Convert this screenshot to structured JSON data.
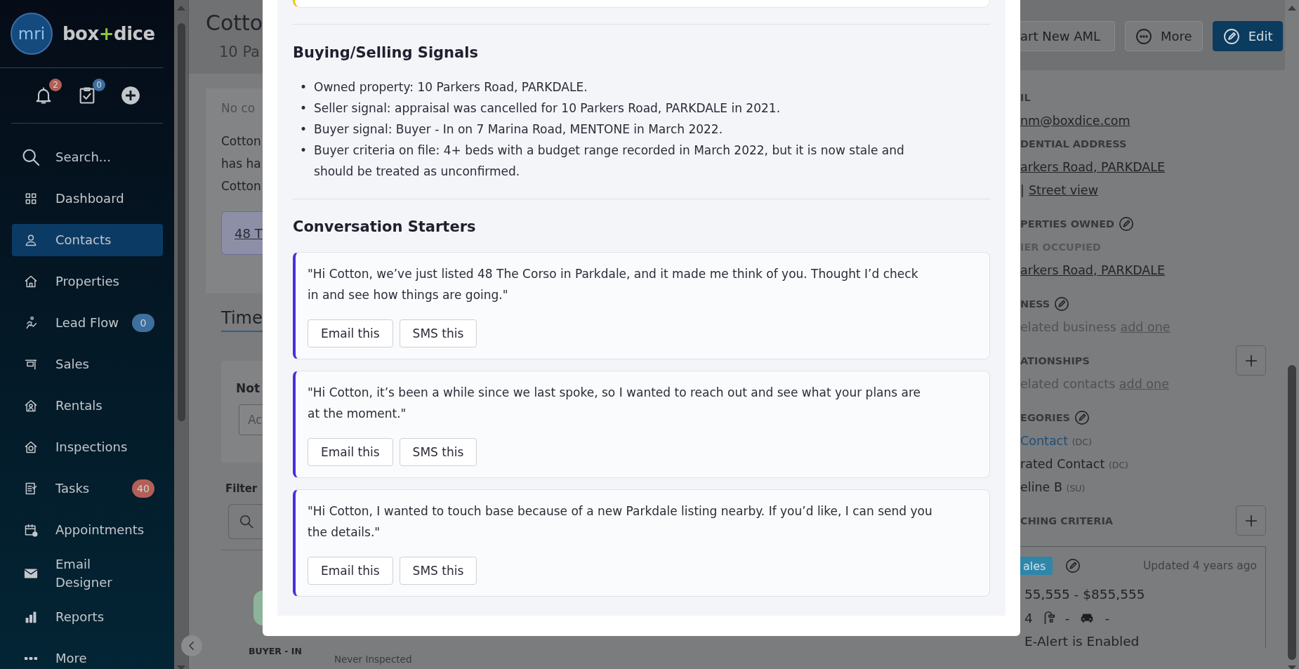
{
  "sidebar": {
    "logo_mark": "mri",
    "brand": {
      "before": "box",
      "joiner": "+",
      "after": "dice"
    },
    "quick_actions": [
      {
        "kind": "notifications",
        "count": "2",
        "color": "#b35f57"
      },
      {
        "kind": "tasks",
        "count": "0",
        "color": "#3d6f9f"
      },
      {
        "kind": "create"
      }
    ],
    "items": [
      {
        "kind": "search",
        "label": "Search...",
        "selected": false
      },
      {
        "kind": "link",
        "label": "Dashboard",
        "selected": false
      },
      {
        "kind": "link",
        "label": "Contacts",
        "selected": true
      },
      {
        "kind": "link",
        "label": "Properties",
        "selected": false
      },
      {
        "kind": "link",
        "label": "Lead Flow",
        "selected": false,
        "badge": "0",
        "color": "#3d6f9f"
      },
      {
        "kind": "link",
        "label": "Sales",
        "selected": false
      },
      {
        "kind": "link",
        "label": "Rentals",
        "selected": false
      },
      {
        "kind": "link",
        "label": "Inspections",
        "selected": false
      },
      {
        "kind": "link",
        "label": "Tasks",
        "selected": false,
        "badge": "40",
        "color": "#b35f57"
      },
      {
        "kind": "link",
        "label": "Appointments",
        "selected": false
      },
      {
        "kind": "link",
        "label": "Email Designer",
        "selected": false
      },
      {
        "kind": "link",
        "label": "Reports",
        "selected": false
      },
      {
        "kind": "link",
        "label": "More",
        "selected": false
      }
    ]
  },
  "contact": {
    "name": "Cotto",
    "address": "10 Pa",
    "summary": {
      "status": "No co",
      "lines": [
        "Cotton",
        "has ha",
        "Cotton"
      ],
      "chip": "48 T"
    },
    "tabs": [
      {
        "label": "Time",
        "selected": true
      }
    ],
    "note": {
      "title": "Not",
      "placeholder": "Ac"
    },
    "filter": {
      "title": "Filter"
    },
    "timeline": {
      "badge": "BUYER - IN",
      "detail": "Never Inspected"
    }
  },
  "actions": [
    {
      "kind": "plain",
      "label": "art New AML"
    },
    {
      "kind": "more",
      "label": "More"
    },
    {
      "kind": "primary",
      "label": "Edit"
    }
  ],
  "details": {
    "rows": [
      {
        "kind": "field_label",
        "text": "IL"
      },
      {
        "kind": "link",
        "text": "nm@boxdice.com"
      },
      {
        "kind": "field_label",
        "text": "DENTIAL ADDRESS"
      },
      {
        "kind": "link",
        "text": "arkers Road, PARKDALE"
      },
      {
        "kind": "link_pair",
        "separator": "|",
        "text": "Street view"
      },
      {
        "kind": "heading",
        "text": "PERTIES OWNED",
        "editable": true,
        "addable": false
      },
      {
        "kind": "subheading",
        "text": "IER OCCUPIED"
      },
      {
        "kind": "link",
        "text": "arkers Road, PARKDALE"
      },
      {
        "kind": "heading",
        "text": "NESS",
        "editable": true,
        "addable": false
      },
      {
        "kind": "empty",
        "text": "elated business",
        "action": "add one"
      },
      {
        "kind": "heading",
        "text": "ATIONSHIPS",
        "editable": false,
        "addable": true
      },
      {
        "kind": "empty",
        "text": "elated contacts",
        "action": "add one"
      },
      {
        "kind": "heading",
        "text": "EGORIES",
        "editable": true,
        "addable": false
      },
      {
        "kind": "category",
        "text": "Contact",
        "code": "(DC)",
        "link": true
      },
      {
        "kind": "category",
        "text": "rated Contact",
        "code": "(DC)",
        "link": false
      },
      {
        "kind": "category",
        "text": "eline B",
        "code": "(SU)",
        "link": false
      },
      {
        "kind": "heading",
        "text": "CHING CRITERIA",
        "editable": false,
        "addable": true
      }
    ]
  },
  "criteria": {
    "tag": "ales",
    "updated": "Updated 4 years ago",
    "price": "55,555 - $855,555",
    "beds": "4",
    "baths": "-",
    "cars": "-",
    "alert": "E-Alert is Enabled"
  },
  "modal": {
    "signals": {
      "title": "Buying/Selling Signals",
      "marker": "•",
      "items": [
        "Owned property: 10 Parkers Road, PARKDALE.",
        "Seller signal: appraisal was cancelled for 10 Parkers Road, PARKDALE in 2021.",
        "Buyer signal: Buyer - In on 7 Marina Road, MENTONE in March 2022.",
        "Buyer criteria on file: 4+ beds with a budget range recorded in March 2022, but it is now stale and should be treated as unconfirmed."
      ]
    },
    "starters": {
      "title": "Conversation Starters",
      "items": [
        {
          "text": "\"Hi Cotton, we’ve just listed 48 The Corso in Parkdale, and it made me think of you. Thought I’d check in and see how things are going.\"",
          "actions": [
            "Email this",
            "SMS this"
          ]
        },
        {
          "text": "\"Hi Cotton, it’s been a while since we last spoke, so I wanted to reach out and see what your plans are at the moment.\"",
          "actions": [
            "Email this",
            "SMS this"
          ]
        },
        {
          "text": "\"Hi Cotton, I wanted to touch base because of a new Parkdale listing nearby. If you’d like, I can send you the details.\"",
          "actions": [
            "Email this",
            "SMS this"
          ]
        }
      ]
    }
  }
}
